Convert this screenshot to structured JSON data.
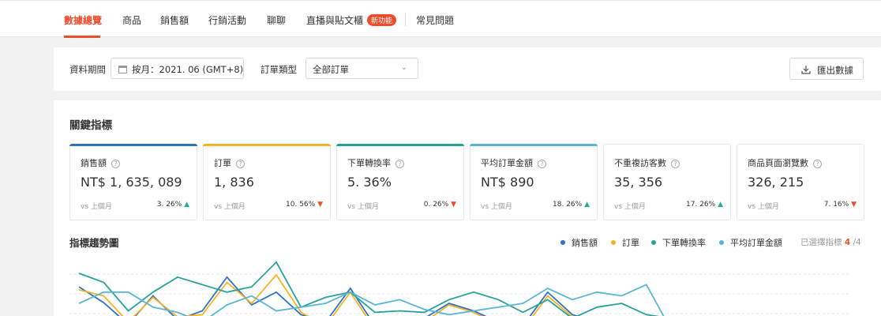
{
  "nav": {
    "tabs": [
      {
        "label": "數據總覽",
        "active": true
      },
      {
        "label": "商品"
      },
      {
        "label": "銷售額"
      },
      {
        "label": "行銷活動"
      },
      {
        "label": "聊聊"
      },
      {
        "label": "直播與貼文櫃",
        "badge": "新功能"
      },
      {
        "label": "常見問題"
      }
    ]
  },
  "filters": {
    "period_label": "資料期間",
    "period_value": "按月：2021. 06 (GMT+8)",
    "order_type_label": "訂單類型",
    "order_type_value": "全部訂單",
    "export_label": "匯出數據"
  },
  "key_metrics": {
    "title": "關鍵指標",
    "compare_label": "vs 上個月",
    "cards": [
      {
        "name": "銷售額",
        "value": "NT$ 1, 635, 089",
        "change": "3. 26%",
        "direction": "up",
        "color": "#2e73c1"
      },
      {
        "name": "訂單",
        "value": "1, 836",
        "change": "10. 56%",
        "direction": "down",
        "color": "#f5b325"
      },
      {
        "name": "下單轉換率",
        "value": "5. 36%",
        "change": "0. 26%",
        "direction": "down",
        "color": "#26a29a"
      },
      {
        "name": "平均訂單金額",
        "value": "NT$ 890",
        "change": "18. 26%",
        "direction": "up",
        "color": "#5bb6d6"
      },
      {
        "name": "不重複訪客數",
        "value": "35, 356",
        "change": "17. 26%",
        "direction": "up",
        "color": null
      },
      {
        "name": "商品頁面瀏覽數",
        "value": "326, 215",
        "change": "7. 16%",
        "direction": "down",
        "color": null
      }
    ]
  },
  "trend": {
    "title": "指標趨勢圖",
    "legend": [
      {
        "name": "銷售額",
        "color": "#2e73c1"
      },
      {
        "name": "訂單",
        "color": "#f5b325"
      },
      {
        "name": "下單轉換率",
        "color": "#26a29a"
      },
      {
        "name": "平均訂單金額",
        "color": "#5bb6d6"
      }
    ],
    "selected_prefix": "已選擇指標",
    "selected_count": "4",
    "selected_total": "/4"
  },
  "chart_data": {
    "type": "line",
    "series": [
      {
        "name": "銷售額",
        "values": [
          62,
          41,
          12,
          50,
          18,
          30,
          75,
          38,
          55,
          25,
          15,
          60,
          10,
          18,
          20,
          40,
          30,
          15,
          10,
          55,
          25,
          15,
          10,
          8,
          10
        ]
      },
      {
        "name": "訂單",
        "values": [
          58,
          50,
          15,
          48,
          22,
          25,
          68,
          40,
          78,
          28,
          10,
          55,
          5,
          12,
          15,
          38,
          28,
          12,
          5,
          50,
          22,
          12,
          8,
          5,
          8
        ]
      },
      {
        "name": "下單轉換率",
        "values": [
          80,
          68,
          30,
          55,
          75,
          65,
          55,
          62,
          95,
          35,
          48,
          55,
          28,
          30,
          28,
          45,
          55,
          45,
          28,
          45,
          20,
          35,
          40,
          25,
          20
        ]
      },
      {
        "name": "平均訂單金額",
        "values": [
          40,
          55,
          55,
          35,
          28,
          15,
          38,
          50,
          30,
          35,
          40,
          55,
          38,
          45,
          32,
          25,
          30,
          35,
          40,
          60,
          45,
          55,
          50,
          65,
          5
        ]
      }
    ]
  }
}
